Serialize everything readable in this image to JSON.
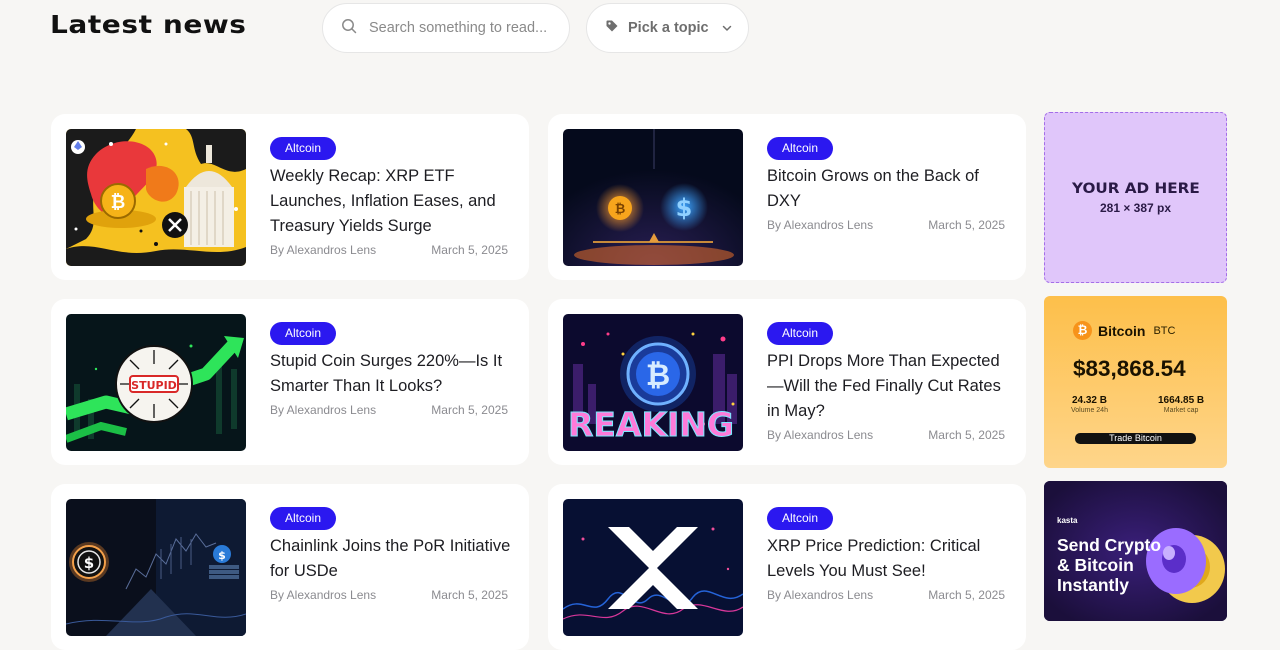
{
  "header": {
    "title": "Latest news",
    "search_placeholder": "Search something to read...",
    "topic_label": "Pick a topic"
  },
  "articles": [
    {
      "tag": "Altcoin",
      "title": "Weekly Recap: XRP ETF Launches, Inflation Eases, and Treasury Yields Surge",
      "author": "By Alexandros Lens",
      "date": "March 5, 2025"
    },
    {
      "tag": "Altcoin",
      "title": "Bitcoin Grows on the Back of DXY",
      "author": "By Alexandros Lens",
      "date": "March 5, 2025"
    },
    {
      "tag": "Altcoin",
      "title": "Stupid Coin Surges 220%—Is It Smarter Than It Looks?",
      "author": "By Alexandros Lens",
      "date": "March 5, 2025"
    },
    {
      "tag": "Altcoin",
      "title": "PPI Drops More Than Expected—Will the Fed Finally Cut Rates in May?",
      "author": "By Alexandros Lens",
      "date": "March 5, 2025"
    },
    {
      "tag": "Altcoin",
      "title": "Chainlink Joins the PoR Initiative for USDe",
      "author": "By Alexandros Lens",
      "date": "March 5, 2025"
    },
    {
      "tag": "Altcoin",
      "title": "XRP Price Prediction: Critical Levels You Must See!",
      "author": "By Alexandros Lens",
      "date": "March 5, 2025"
    }
  ],
  "thumb_text": {
    "stupid": "STUPID",
    "breaking": "REAKING"
  },
  "ad": {
    "title": "YOUR AD HERE",
    "size": "281 × 387 px"
  },
  "btc_widget": {
    "logo": "₿",
    "name": "Bitcoin",
    "symbol": "BTC",
    "price": "$83,868.54",
    "volume_value": "24.32 B",
    "volume_label": "Volume 24h",
    "mcap_value": "1664.85 B",
    "mcap_label": "Market cap",
    "cta": "Trade Bitcoin"
  },
  "kasta_ad": {
    "brand": "kasta",
    "text": "Send Crypto & Bitcoin Instantly"
  },
  "colors": {
    "accent": "#2b18f0",
    "background": "#f7f6f4",
    "ad_purple": "#e0c6fa",
    "btc_orange": "#f7931a"
  }
}
